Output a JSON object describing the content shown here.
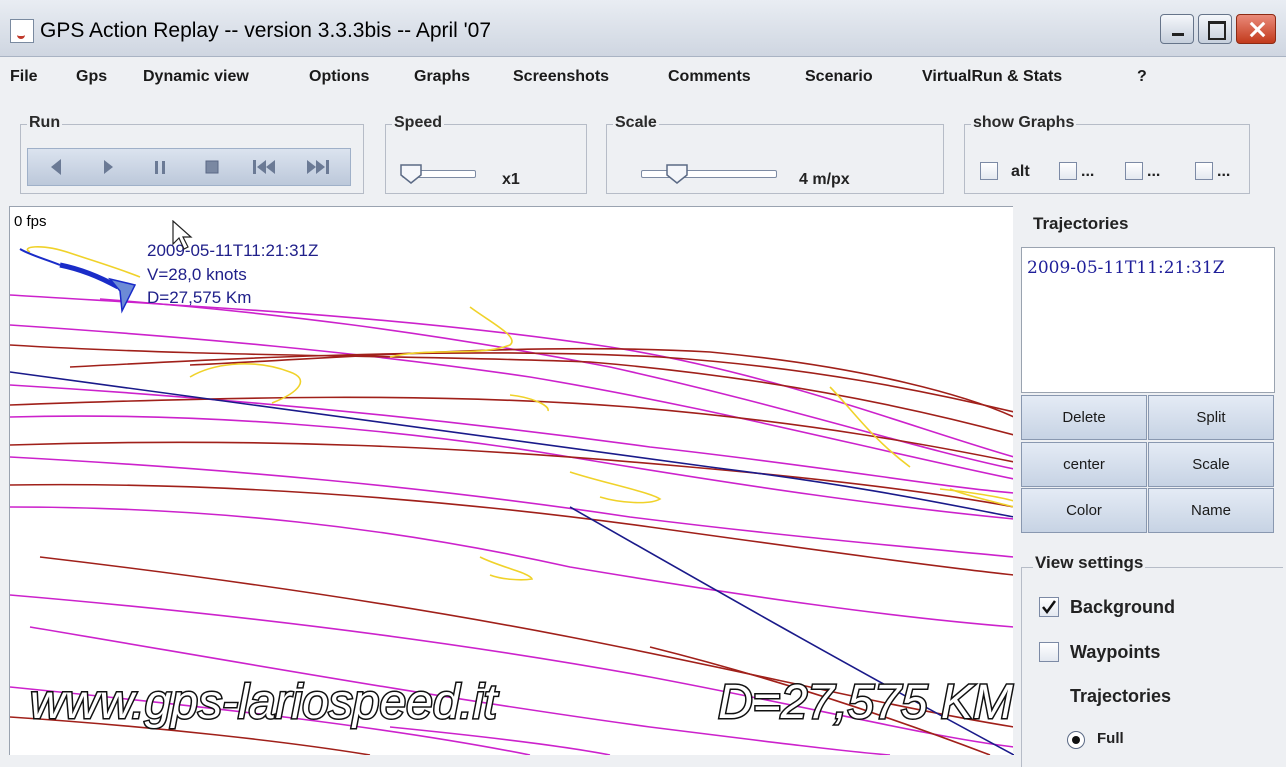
{
  "window": {
    "title": "GPS Action Replay -- version 3.3.3bis -- April '07"
  },
  "menu": [
    "File",
    "Gps",
    "Dynamic view",
    "Options",
    "Graphs",
    "Screenshots",
    "Comments",
    "Scenario",
    "VirtualRun & Stats",
    "?"
  ],
  "toolbar": {
    "run": {
      "label": "Run",
      "buttons": [
        "rewind-step",
        "play",
        "pause",
        "stop",
        "skip-to-start",
        "skip-to-end"
      ]
    },
    "speed": {
      "label": "Speed",
      "value": "x1",
      "level": 0.1
    },
    "scale": {
      "label": "Scale",
      "value": "4 m/px",
      "level": 0.25
    },
    "show_graphs": {
      "label": "show Graphs",
      "options": [
        {
          "label": "alt",
          "checked": false
        },
        {
          "label": "...",
          "checked": false
        },
        {
          "label": "...",
          "checked": false
        },
        {
          "label": "...",
          "checked": false
        }
      ]
    }
  },
  "map": {
    "fps": "0 fps",
    "info_time": "2009-05-11T11:21:31Z",
    "info_speed": "V=28,0 knots",
    "info_distance": "D=27,575 Km",
    "track_colors": {
      "magenta": "#cc22cc",
      "maroon": "#a0201a",
      "yellow": "#f0d22a",
      "navy": "#1a1a8a"
    }
  },
  "trajectories": {
    "title": "Trajectories",
    "items": [
      "2009-05-11T11:21:31Z"
    ],
    "buttons": {
      "delete": "Delete",
      "split": "Split",
      "center": "center",
      "scale": "Scale",
      "color": "Color",
      "name": "Name"
    }
  },
  "view_settings": {
    "title": "View settings",
    "background": {
      "label": "Background",
      "checked": true
    },
    "waypoints": {
      "label": "Waypoints",
      "checked": false
    },
    "trajectories": {
      "label": "Trajectories"
    },
    "full": {
      "label": "Full",
      "selected": true
    }
  },
  "overlay": {
    "website": "www.gps-lariospeed.it",
    "distance": "D=27,575 KM"
  }
}
